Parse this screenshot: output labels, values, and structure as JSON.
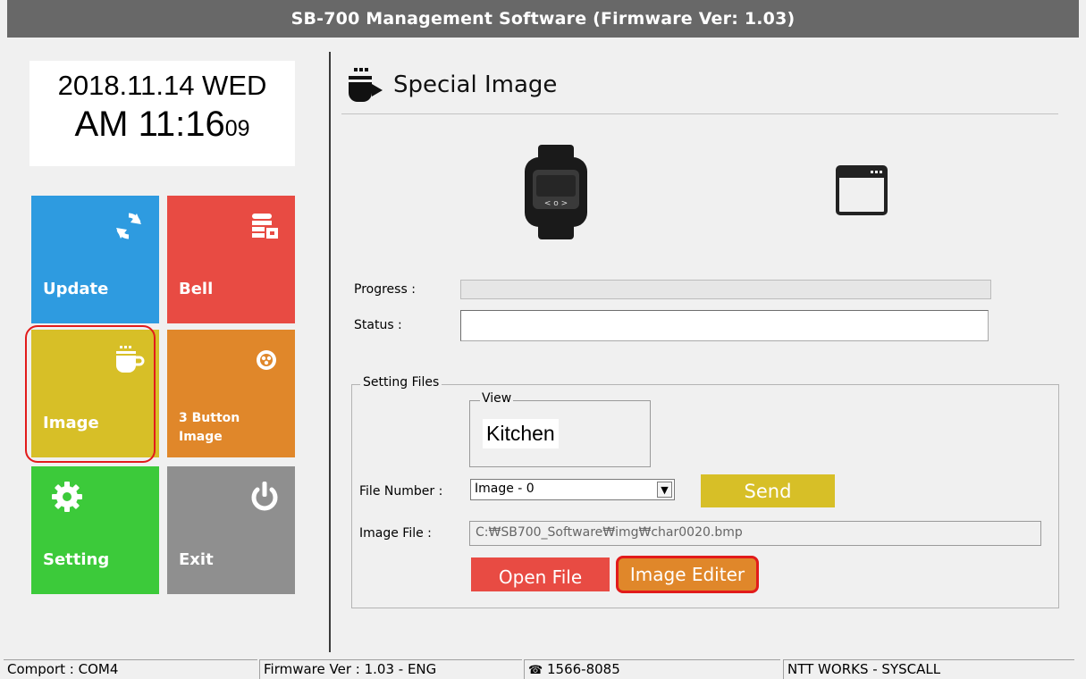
{
  "window": {
    "title": "SB-700 Management Software (Firmware Ver: 1.03)"
  },
  "clock": {
    "date": "2018.11.14 WED",
    "time": "AM 11:16",
    "seconds": "09"
  },
  "tiles": [
    {
      "label": "Update",
      "icon": "sync-icon",
      "color": "#2e9be0"
    },
    {
      "label": "Bell",
      "icon": "bell-list-icon",
      "color": "#e84b43"
    },
    {
      "label": "Image",
      "icon": "coffee-cup-icon",
      "color": "#d7bf27",
      "highlighted": true
    },
    {
      "label_line1": "3 Button",
      "label_line2": "Image",
      "icon": "three-button-icon",
      "color": "#e0872a"
    },
    {
      "label": "Setting",
      "icon": "gear-icon",
      "color": "#3cca3a"
    },
    {
      "label": "Exit",
      "icon": "power-icon",
      "color": "#8f8f8f"
    }
  ],
  "main": {
    "title": "Special Image",
    "title_icon": "coffee-cup-icon",
    "device_icon": "pager-watch-icon",
    "window_icon": "window-icon",
    "progress_label": "Progress :",
    "progress_value": 0,
    "status_label": "Status :",
    "status_value": "",
    "setting_files": {
      "group_title": "Setting Files",
      "view_title": "View",
      "view_text": "Kitchen",
      "file_number_label": "File Number :",
      "file_number_value": "Image - 0",
      "send_label": "Send",
      "image_file_label": "Image File :",
      "image_file_value": "C:₩SB700_Software₩img₩char0020.bmp",
      "open_file_label": "Open File",
      "image_editer_label": "Image Editer"
    }
  },
  "statusbar": {
    "comport": "Comport : COM4",
    "firmware": "Firmware Ver : 1.03 - ENG",
    "phone": "1566-8085",
    "company": "NTT WORKS - SYSCALL"
  }
}
